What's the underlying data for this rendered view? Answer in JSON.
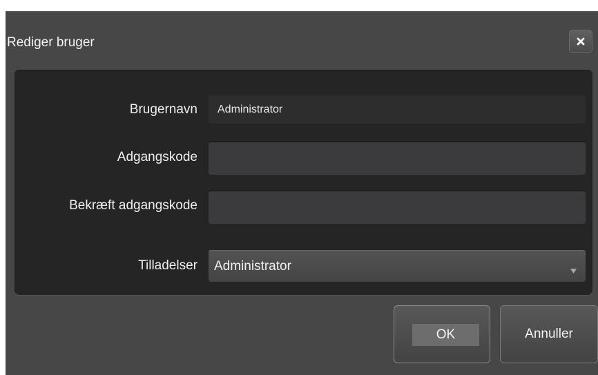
{
  "dialog": {
    "title": "Rediger bruger",
    "close_icon": "close-icon"
  },
  "form": {
    "username_label": "Brugernavn",
    "username_value": "Administrator",
    "password_label": "Adgangskode",
    "password_value": "",
    "confirm_label": "Bekræft adgangskode",
    "confirm_value": "",
    "permissions_label": "Tilladelser",
    "permissions_value": "Administrator",
    "permissions_icon": "chevron-down-icon"
  },
  "buttons": {
    "ok_label": "OK",
    "cancel_label": "Annuller"
  },
  "colors": {
    "dialog_bg": "#474747",
    "panel_bg": "#252525",
    "input_bg": "#3b3b3d"
  }
}
